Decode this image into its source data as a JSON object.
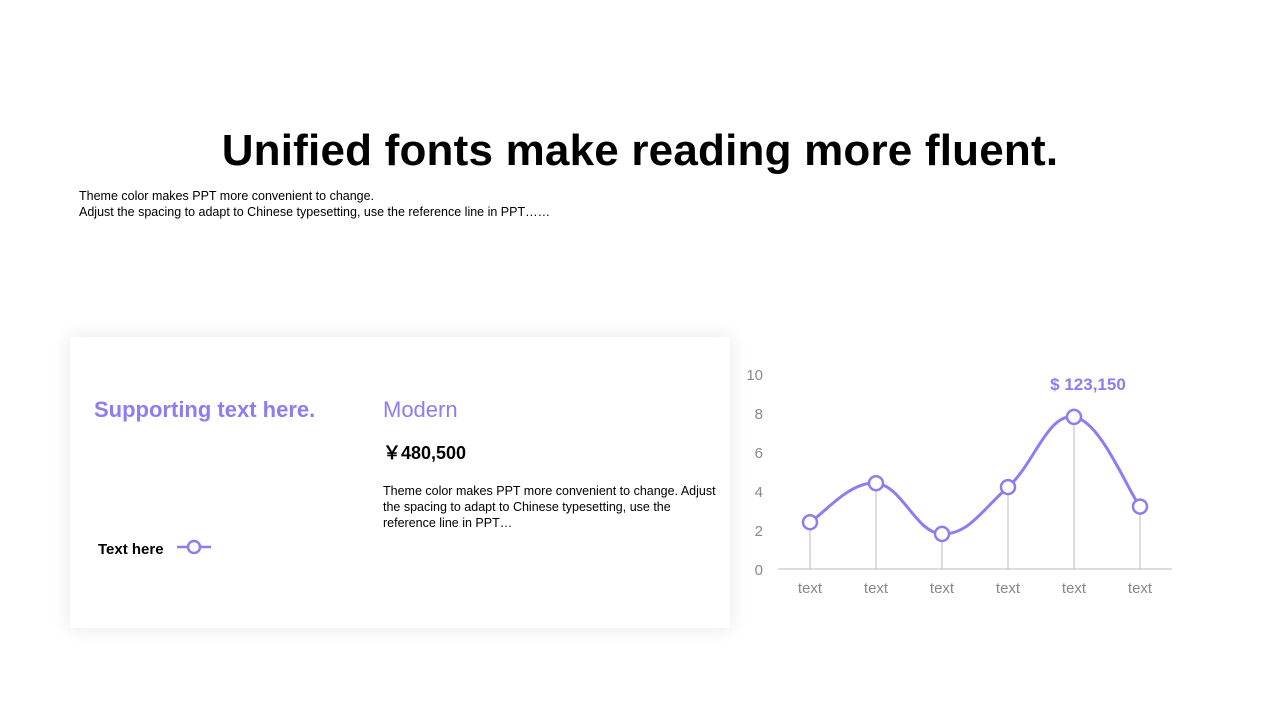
{
  "title": "Unified fonts make reading more fluent.",
  "subtitle": {
    "line1": "Theme color makes PPT more convenient to change.",
    "line2": "Adjust the spacing to adapt to Chinese typesetting, use the reference line in PPT……"
  },
  "card": {
    "supporting_text": "Supporting text here.",
    "legend_label": "Text here",
    "heading": "Modern",
    "price": "￥480,500",
    "description": "Theme color makes PPT more convenient to change. Adjust the spacing to adapt to Chinese typesetting, use the reference line in PPT…"
  },
  "colors": {
    "accent": "#8e7cf0",
    "axis_text": "#888888",
    "gridline": "#bbbbbb"
  },
  "icons": {
    "legend": "line-circle-marker-icon"
  },
  "chart_data": {
    "type": "line",
    "smooth": true,
    "categories": [
      "text",
      "text",
      "text",
      "text",
      "text",
      "text"
    ],
    "values": [
      2.4,
      4.4,
      1.8,
      4.2,
      7.8,
      3.2
    ],
    "ylim": [
      0,
      10
    ],
    "yticks": [
      0,
      2,
      4,
      6,
      8,
      10
    ],
    "grid": false,
    "drop_lines": true,
    "annotation": {
      "text": "$ 123,150",
      "point_index": 4
    }
  }
}
